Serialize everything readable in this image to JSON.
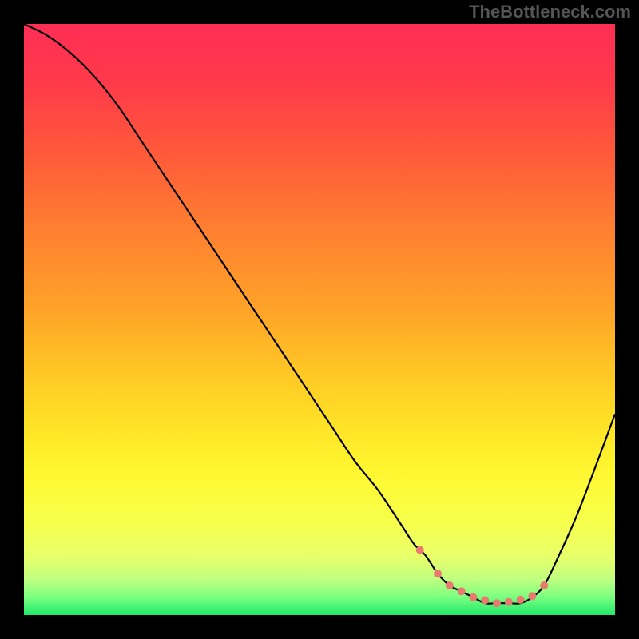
{
  "watermark": "TheBottleneck.com",
  "chart_data": {
    "type": "line",
    "title": "",
    "xlabel": "",
    "ylabel": "",
    "xlim": [
      0,
      100
    ],
    "ylim": [
      0,
      100
    ],
    "series": [
      {
        "name": "curve",
        "x": [
          0,
          4,
          8,
          12,
          16,
          20,
          24,
          28,
          32,
          36,
          40,
          44,
          48,
          52,
          56,
          60,
          64,
          66,
          68,
          70,
          72,
          74,
          76,
          78,
          80,
          82,
          84,
          86,
          88,
          90,
          94,
          100
        ],
        "y": [
          100,
          98,
          95,
          91,
          86,
          80,
          74,
          68,
          62,
          56,
          50,
          44,
          38,
          32,
          26,
          21,
          15,
          12,
          10,
          7,
          5,
          4,
          3,
          2,
          2,
          2,
          2,
          3,
          5,
          9,
          18,
          34
        ]
      }
    ],
    "marker_points": {
      "x": [
        67,
        70,
        72,
        74,
        76,
        78,
        80,
        82,
        84,
        86,
        88
      ],
      "y": [
        11,
        7,
        5,
        4,
        3,
        2.5,
        2,
        2.2,
        2.6,
        3.2,
        5
      ]
    },
    "colors": {
      "curve": "#000000",
      "markers": "#e87a70",
      "gradient_top": "#ff2e55",
      "gradient_bottom": "#20e86a"
    }
  }
}
